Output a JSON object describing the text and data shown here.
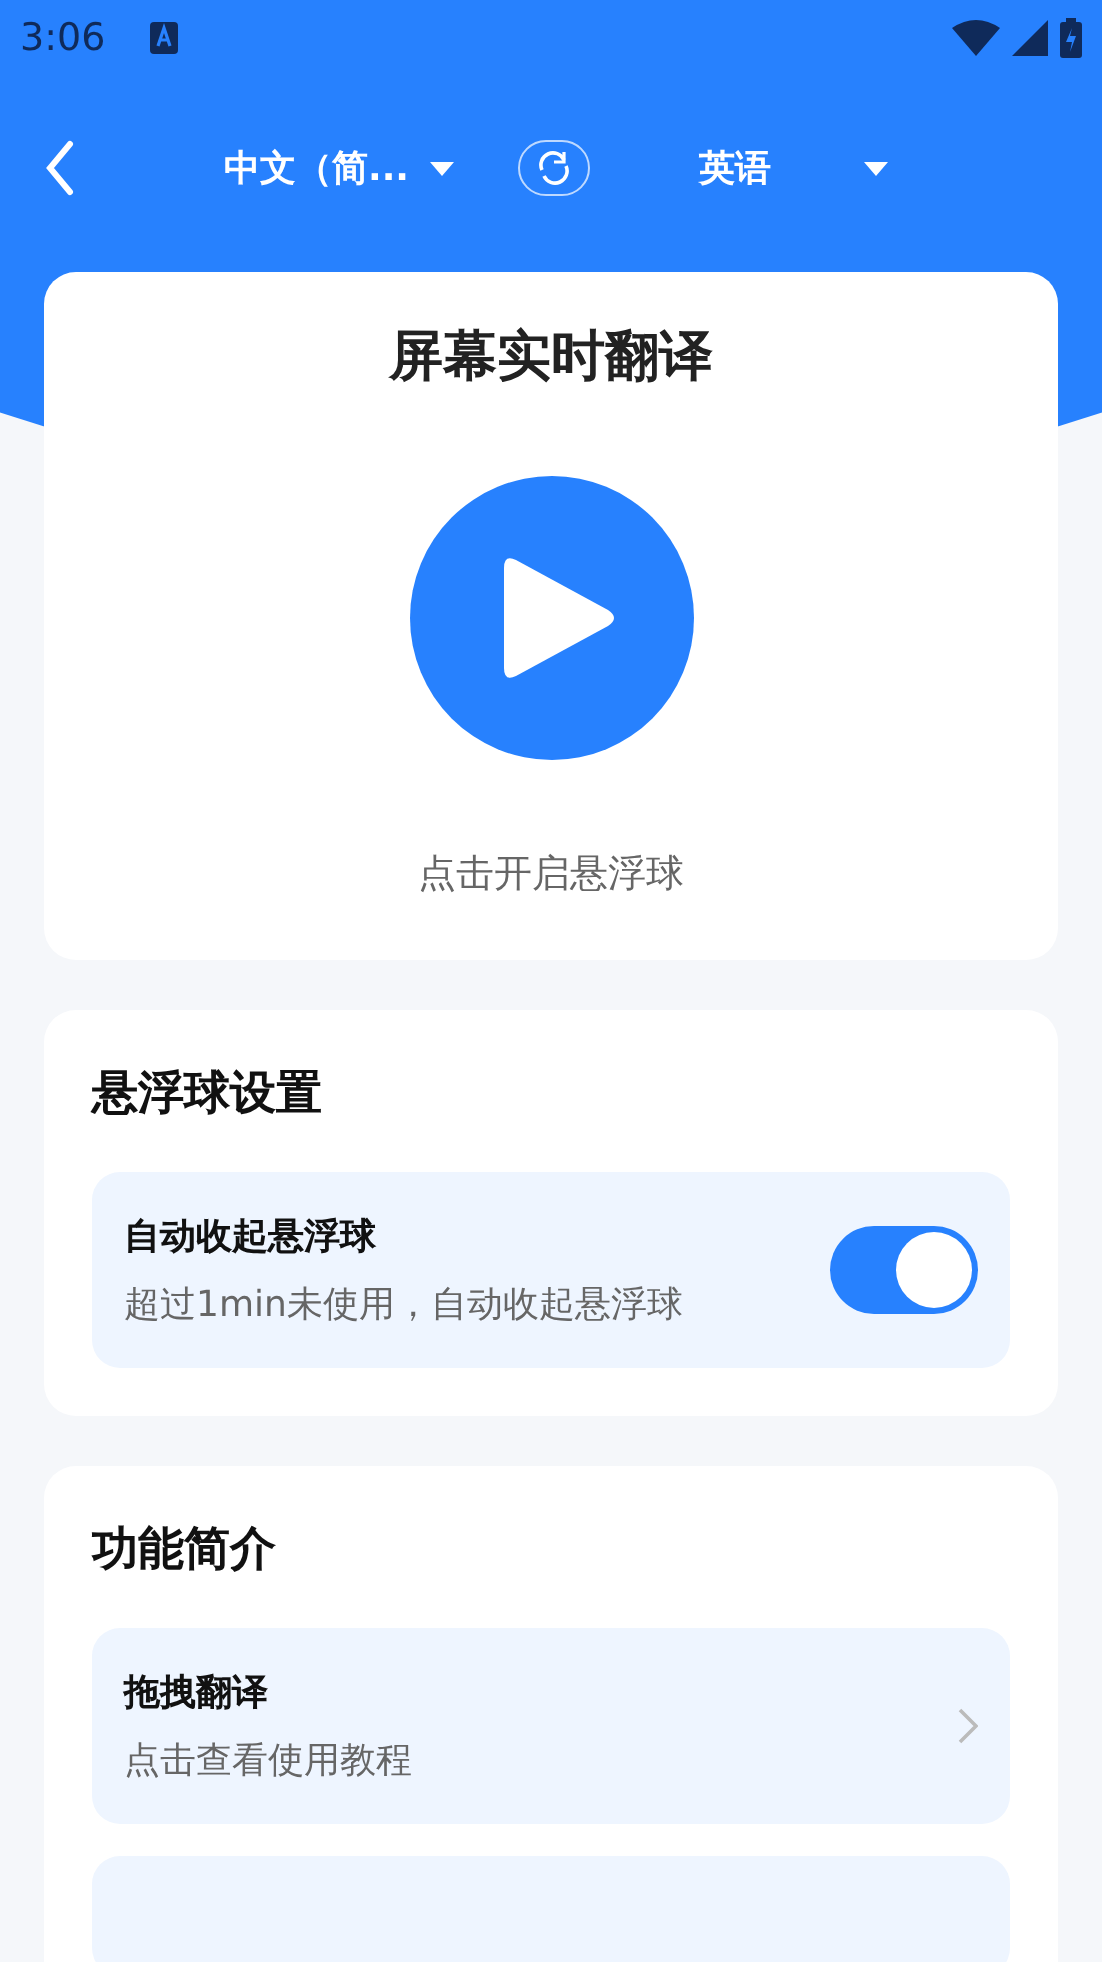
{
  "status_bar": {
    "time": "3:06"
  },
  "header": {
    "source_language": "中文（简...",
    "target_language": "英语"
  },
  "main_card": {
    "title": "屏幕实时翻译",
    "hint": "点击开启悬浮球"
  },
  "floating_settings": {
    "title": "悬浮球设置",
    "items": [
      {
        "title": "自动收起悬浮球",
        "subtitle": "超过1min未使用，自动收起悬浮球",
        "on": true
      }
    ]
  },
  "intro": {
    "title": "功能简介",
    "items": [
      {
        "title": "拖拽翻译",
        "subtitle": "点击查看使用教程"
      }
    ]
  }
}
